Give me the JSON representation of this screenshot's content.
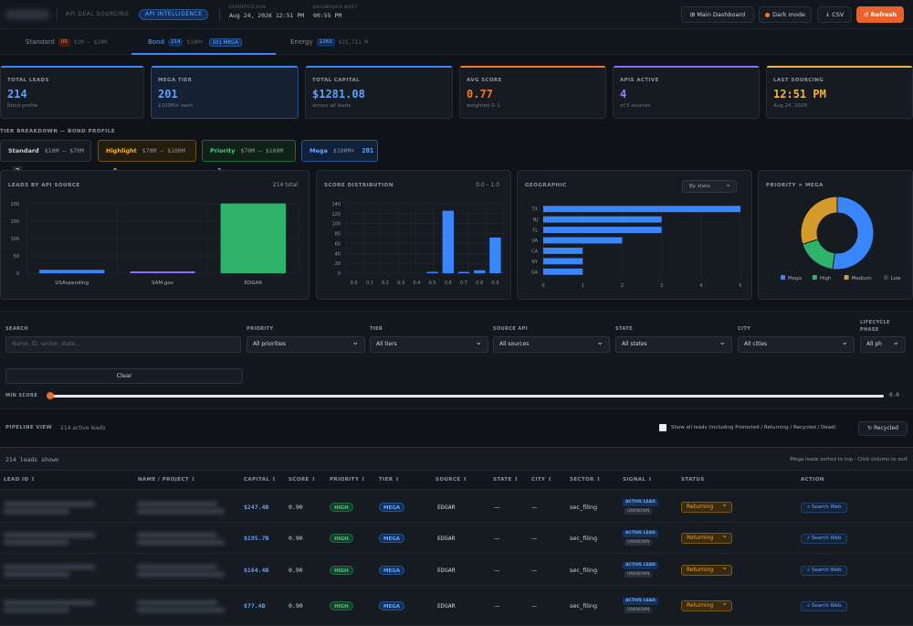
{
  "header": {
    "brand_sub": "API DEAL SOURCING",
    "brand_pill": "API INTELLIGENCE",
    "meta": [
      {
        "k": "REPORTED RUN",
        "v": "Aug 24, 2026 12:51 PM"
      },
      {
        "k": "DASHBOARD BUILT",
        "v": "00:55 PM"
      }
    ],
    "buttons": {
      "main_dashboard": "⊞ Main Dashboard",
      "dark_mode": "Dark mode",
      "csv": "↓ CSV",
      "refresh": "↺ Refresh"
    }
  },
  "tabs": [
    {
      "name": "Standard",
      "badge": "06",
      "range": "$1M – $10M"
    },
    {
      "name": "Bond",
      "badge": "214",
      "range": "$10M+",
      "extra": "201 MEGA"
    },
    {
      "name": "Energy",
      "badge": "1263",
      "range": "$15,711 M"
    }
  ],
  "kpis": [
    {
      "label": "TOTAL LEADS",
      "value": "214",
      "sub": "Bond profile",
      "color": "#5aa0ff",
      "accent": "#3a86ff"
    },
    {
      "label": "MEGA TIER",
      "value": "201",
      "sub": "$100M+ each",
      "color": "#5aa0ff",
      "accent": "#3a86ff"
    },
    {
      "label": "TOTAL CAPITAL",
      "value": "$1281.08",
      "sub": "across all leads",
      "color": "#5aa0ff",
      "accent": "#3a86ff"
    },
    {
      "label": "AVG SCORE",
      "value": "0.77",
      "sub": "weighted 0–1",
      "color": "#f07a2a",
      "accent": "#f07a2a"
    },
    {
      "label": "APIS ACTIVE",
      "value": "4",
      "sub": "of 5 sources",
      "color": "#9b7bff",
      "accent": "#8b6bff"
    },
    {
      "label": "LAST SOURCING",
      "value": "12:51 PM",
      "sub": "Aug 24, 2026",
      "color": "#f2b53a",
      "accent": "#f2b53a"
    }
  ],
  "tier_breakdown": {
    "label": "TIER BREAKDOWN — BOND PROFILE",
    "tiers": [
      {
        "name": "Standard",
        "range": "$10M – $70M",
        "count": "2",
        "color": "#c9d1d9",
        "border": "#2b333d",
        "bg": "#161b22"
      },
      {
        "name": "Highlight",
        "range": "$70M – $100M",
        "count": "0",
        "color": "#f2b53a",
        "border": "#6b5217",
        "bg": "#241d0d"
      },
      {
        "name": "Priority",
        "range": "$70M – $100M",
        "count": "3",
        "color": "#3fd17f",
        "border": "#1f6b43",
        "bg": "#102218"
      },
      {
        "name": "Mega",
        "range": "$100M+",
        "count": "201",
        "color": "#6aa8ff",
        "border": "#24569a",
        "bg": "#102039"
      }
    ]
  },
  "panels": {
    "leads_by_source": {
      "title": "LEADS BY API SOURCE",
      "right": "214 total"
    },
    "score_dist": {
      "title": "SCORE DISTRIBUTION",
      "right": "0.0 – 1.0"
    },
    "geo": {
      "title": "GEOGRAPHIC",
      "select": "By state"
    },
    "donut": {
      "title": "PRIORITY × MEGA"
    }
  },
  "chart_data": [
    {
      "type": "bar",
      "title": "LEADS BY API SOURCE",
      "categories": [
        "USAspending",
        "SAM.gov",
        "EDGAR"
      ],
      "values": [
        10,
        3,
        201
      ],
      "ylim": [
        0,
        200
      ],
      "yticks": [
        "200",
        "150",
        "100",
        "50",
        "0"
      ],
      "colors": [
        "#3a86ff",
        "#8b6bff",
        "#2fb36b"
      ]
    },
    {
      "type": "bar",
      "title": "SCORE DISTRIBUTION",
      "categories": [
        "0.0",
        "0.1",
        "0.2",
        "0.3",
        "0.4",
        "0.5",
        "0.6",
        "0.7",
        "0.8",
        "0.9"
      ],
      "values": [
        0,
        0,
        0,
        0,
        0,
        2,
        126,
        1,
        6,
        72
      ],
      "ylim": [
        0,
        140
      ],
      "yticks": [
        "140",
        "120",
        "100",
        "80",
        "60",
        "40",
        "20",
        "0"
      ],
      "color": "#3a86ff"
    },
    {
      "type": "bar",
      "title": "GEOGRAPHIC",
      "orientation": "horizontal",
      "categories": [
        "TX",
        "NJ",
        "FL",
        "VA",
        "CA",
        "NY",
        "GA"
      ],
      "values": [
        5,
        3,
        3,
        2,
        1,
        1,
        1
      ],
      "xlim": [
        0,
        5
      ],
      "xticks": [
        "0",
        "1",
        "2",
        "3",
        "4",
        "5"
      ],
      "color": "#3a86ff"
    },
    {
      "type": "pie",
      "title": "PRIORITY × MEGA",
      "categories": [
        "Mega",
        "High",
        "Medium",
        "Low"
      ],
      "values": [
        52,
        18,
        30,
        0
      ],
      "colors": [
        "#3a86ff",
        "#2fb36b",
        "#d49a2a",
        "#3a414b"
      ]
    }
  ],
  "filters": {
    "search_label": "SEARCH",
    "search_placeholder": "Name, ID, sector, state...",
    "fields": [
      {
        "label": "PRIORITY",
        "value": "All priorities"
      },
      {
        "label": "TIER",
        "value": "All tiers"
      },
      {
        "label": "SOURCE API",
        "value": "All sources"
      },
      {
        "label": "STATE",
        "value": "All states"
      },
      {
        "label": "CITY",
        "value": "All cities"
      },
      {
        "label": "LIFECYCLE PHASE",
        "value": "All ph"
      }
    ],
    "clear": "Clear",
    "min_score_label": "MIN SCORE",
    "min_score_value": "0.0",
    "min_score": 0.0
  },
  "pipeline": {
    "title": "PIPELINE VIEW",
    "count": "214 active leads",
    "checkbox_label": "Show all leads (including Promoted / Returning / Recycled / Dead)",
    "recycled": "↻ Recycled"
  },
  "table": {
    "shown": "214 leads shown",
    "hint": "Mega leads sorted to top · Click column to sort",
    "headers": [
      "LEAD ID ↕",
      "NAME / PROJECT ↕",
      "CAPITAL ↕",
      "SCORE ↕",
      "PRIORITY ↕",
      "TIER ↕",
      "SOURCE ↕",
      "STATE ↕",
      "CITY ↕",
      "SECTOR ↕",
      "SIGNAL ↕",
      "STATUS",
      "ACTION"
    ],
    "rows": [
      {
        "capital": "$247.4B",
        "score": "0.90",
        "priority": "HIGH",
        "tier": "MEGA",
        "source": "EDGAR",
        "state": "—",
        "city": "—",
        "sector": "sec_filing",
        "signal1": "ACTIVE LEAD",
        "signal2": "UNKNOWN",
        "status": "Returning",
        "action": "⌕ Search Web"
      },
      {
        "capital": "$195.7B",
        "score": "0.90",
        "priority": "HIGH",
        "tier": "MEGA",
        "source": "EDGAR",
        "state": "—",
        "city": "—",
        "sector": "sec_filing",
        "signal1": "ACTIVE LEAD",
        "signal2": "UNKNOWN",
        "status": "Returning",
        "action": "⌕ Search Web"
      },
      {
        "capital": "$164.4B",
        "score": "0.90",
        "priority": "HIGH",
        "tier": "MEGA",
        "source": "EDGAR",
        "state": "—",
        "city": "—",
        "sector": "sec_filing",
        "signal1": "ACTIVE LEAD",
        "signal2": "UNKNOWN",
        "status": "Returning",
        "action": "⌕ Search Web"
      },
      {
        "capital": "$77.4B",
        "score": "0.90",
        "priority": "HIGH",
        "tier": "MEGA",
        "source": "EDGAR",
        "state": "—",
        "city": "—",
        "sector": "sec_filing",
        "signal1": "ACTIVE LEAD",
        "signal2": "UNKNOWN",
        "status": "Returning",
        "action": "⌕ Search Web"
      }
    ]
  }
}
